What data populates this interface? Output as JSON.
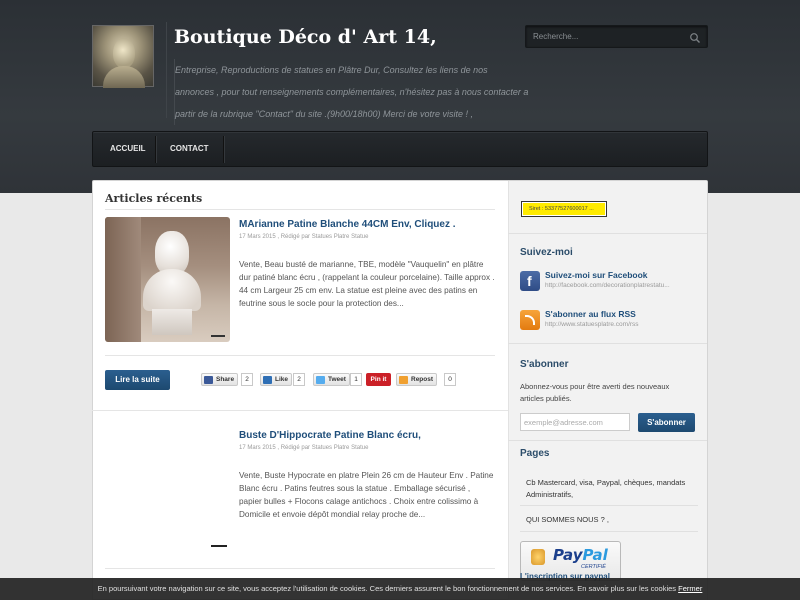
{
  "site": {
    "title": "Boutique Déco d' Art 14,",
    "tagline": "Entreprise, Reproductions de statues en Plâtre Dur, Consultez les liens de nos annonces , pour tout renseignements complémentaires, n'hésitez pas à nous contacter a partir de la rubrique \"Contact\" du site .(9h00/18h00) Merci de votre visite ! ,"
  },
  "search": {
    "placeholder": "Recherche..."
  },
  "nav": {
    "items": [
      {
        "label": "ACCUEIL"
      },
      {
        "label": "CONTACT"
      }
    ]
  },
  "main": {
    "heading": "Articles récents",
    "posts": [
      {
        "title": "MArianne Patine Blanche 44CM Env, Cliquez .",
        "meta": "17 Mars 2015 , Rédigé par Statues Platre Statue",
        "excerpt": "Vente, Beau busté de marianne, TBE, modèle \"Vauquelin\" en plâtre dur patiné blanc écru , (rappelant la couleur porcelaine). Taille approx . 44 cm Largeur 25 cm env. La statue est pleine avec des patins en feutrine sous le socle pour la protection des..."
      },
      {
        "title": "Buste D'Hippocrate Patine Blanc écru,",
        "meta": "17 Mars 2015 , Rédigé par Statues Platre Statue",
        "excerpt": "Vente, Buste Hypocrate en platre Plein 26 cm de Hauteur Env . Patine Blanc écru . Patins feutres sous la statue . Emballage sécurisé , papier bulles + Flocons calage antichocs . Choix entre colissimo à Domicile et envoie dépôt mondial relay proche de..."
      }
    ],
    "read_more": "Lire la suite",
    "share": {
      "facebook": {
        "label": "Share",
        "count": "2"
      },
      "linkedin": {
        "label": "Like",
        "count": "2"
      },
      "twitter": {
        "label": "Tweet",
        "count": "1"
      },
      "pinterest": {
        "label": "Pin it"
      },
      "repost": {
        "label": "Repost",
        "count": "0"
      }
    }
  },
  "sidebar": {
    "ad_text": "Siret : 53377527600017 ...",
    "follow": {
      "heading": "Suivez-moi",
      "facebook": {
        "title": "Suivez-moi sur Facebook",
        "url": "http://facebook.com/decorationplatrestatu..."
      },
      "rss": {
        "title": "S'abonner au flux RSS",
        "url": "http://www.statuesplatre.com/rss"
      }
    },
    "subscribe": {
      "heading": "S'abonner",
      "text": "Abonnez-vous pour être averti des nouveaux articles publiés.",
      "email_placeholder": "exemple@adresse.com",
      "button": "S'abonner"
    },
    "pages": {
      "heading": "Pages",
      "items": [
        {
          "label": "Cb Mastercard, visa, Paypal, chèques, mandats Administratifs,"
        },
        {
          "label": "QUI SOMMES NOUS ? ,"
        }
      ]
    },
    "paypal": {
      "logo_a": "Pay",
      "logo_b": "Pal",
      "certified": "CERTIFIÉ",
      "caption": "L'inscription sur paypal"
    }
  },
  "cookie": {
    "text": "En poursuivant votre navigation sur ce site, vous acceptez l'utilisation de cookies. Ces derniers assurent le bon fonctionnement de nos services. En savoir plus sur les cookies",
    "link": "Fermer"
  },
  "colors": {
    "accent": "#1f4e7a",
    "button": "#1d4970",
    "header": "#2f3338"
  }
}
